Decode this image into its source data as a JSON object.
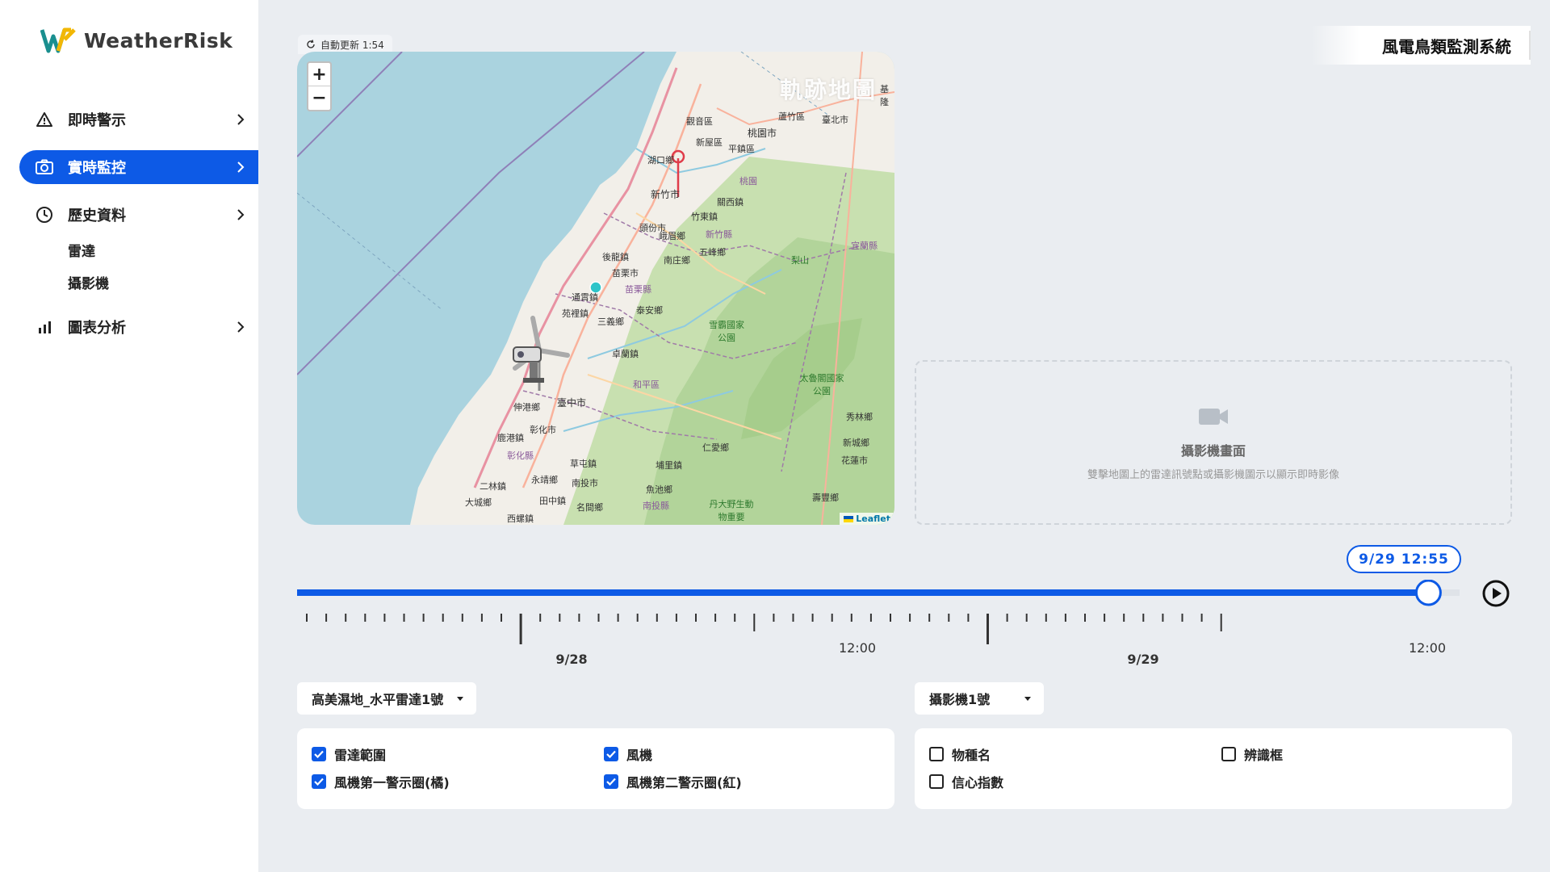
{
  "app": {
    "brand": "WeatherRisk",
    "system_title": "風電鳥類監測系統"
  },
  "sidebar": {
    "items": [
      {
        "label": "即時警示",
        "icon": "warning-triangle-icon",
        "active": false
      },
      {
        "label": "實時監控",
        "icon": "camera-icon",
        "active": true
      },
      {
        "label": "歷史資料",
        "icon": "clock-icon",
        "active": false
      },
      {
        "label": "圖表分析",
        "icon": "bar-chart-icon",
        "active": false
      }
    ],
    "history_sub": [
      "雷達",
      "攝影機"
    ]
  },
  "map": {
    "auto_update": "自動更新 1:54",
    "title": "軌跡地圖",
    "zoom_in": "+",
    "zoom_out": "−",
    "attribution": "Leaflet",
    "labels": [
      "臺北市",
      "桃園市",
      "新竹市",
      "竹東鎮",
      "後龍鎮",
      "苗栗市",
      "苗栗縣",
      "通霄鎮",
      "苑裡鎮",
      "三義鄉",
      "卓蘭鎮",
      "臺中市",
      "彰化市",
      "彰化縣",
      "南投市",
      "南投縣",
      "埔里鎮",
      "宜蘭縣",
      "花蓮市",
      "觀音區",
      "新屋區",
      "平鎮區",
      "湖口鄉",
      "新竹縣",
      "五峰鄉",
      "南庄鄉",
      "泰安鄉",
      "和平區",
      "仁愛鄉",
      "魚池鄉",
      "太魯閣國家公園",
      "雪霸國家公園",
      "丹大野生動物重要",
      "梨山",
      "伸港鄉",
      "鹿港鎮",
      "草屯鎮",
      "二林鎮",
      "大城鄉",
      "西螺鎮",
      "田中鎮",
      "名間鄉",
      "永靖鄉",
      "秀林鄉",
      "新城鄉",
      "壽豐鄉",
      "基隆",
      "關西鎮",
      "峨眉鄉",
      "頭份市",
      "南投",
      "蘆竹區",
      "桃園"
    ]
  },
  "camera_panel": {
    "title": "攝影機畫面",
    "hint": "雙擊地圖上的雷達訊號點或攝影機圖示以顯示即時影像"
  },
  "timeline": {
    "current": "9/29 12:55",
    "major_labels": [
      "9/28",
      "12:00",
      "9/29",
      "12:00"
    ],
    "progress": 0.98
  },
  "radar_select": {
    "value": "高美濕地_水平雷達1號"
  },
  "camera_select": {
    "value": "攝影機1號"
  },
  "radar_options": [
    {
      "label": "雷達範圍",
      "checked": true
    },
    {
      "label": "風機",
      "checked": true
    },
    {
      "label": "風機第一警示圈(橘)",
      "checked": true
    },
    {
      "label": "風機第二警示圈(紅)",
      "checked": true
    }
  ],
  "camera_options": [
    {
      "label": "物種名",
      "checked": false
    },
    {
      "label": "辨識框",
      "checked": false
    },
    {
      "label": "信心指數",
      "checked": false
    }
  ],
  "colors": {
    "accent": "#0d5ae6",
    "sea": "#aad3df",
    "land": "#f2efe9",
    "forest": "#b9d9a4"
  }
}
